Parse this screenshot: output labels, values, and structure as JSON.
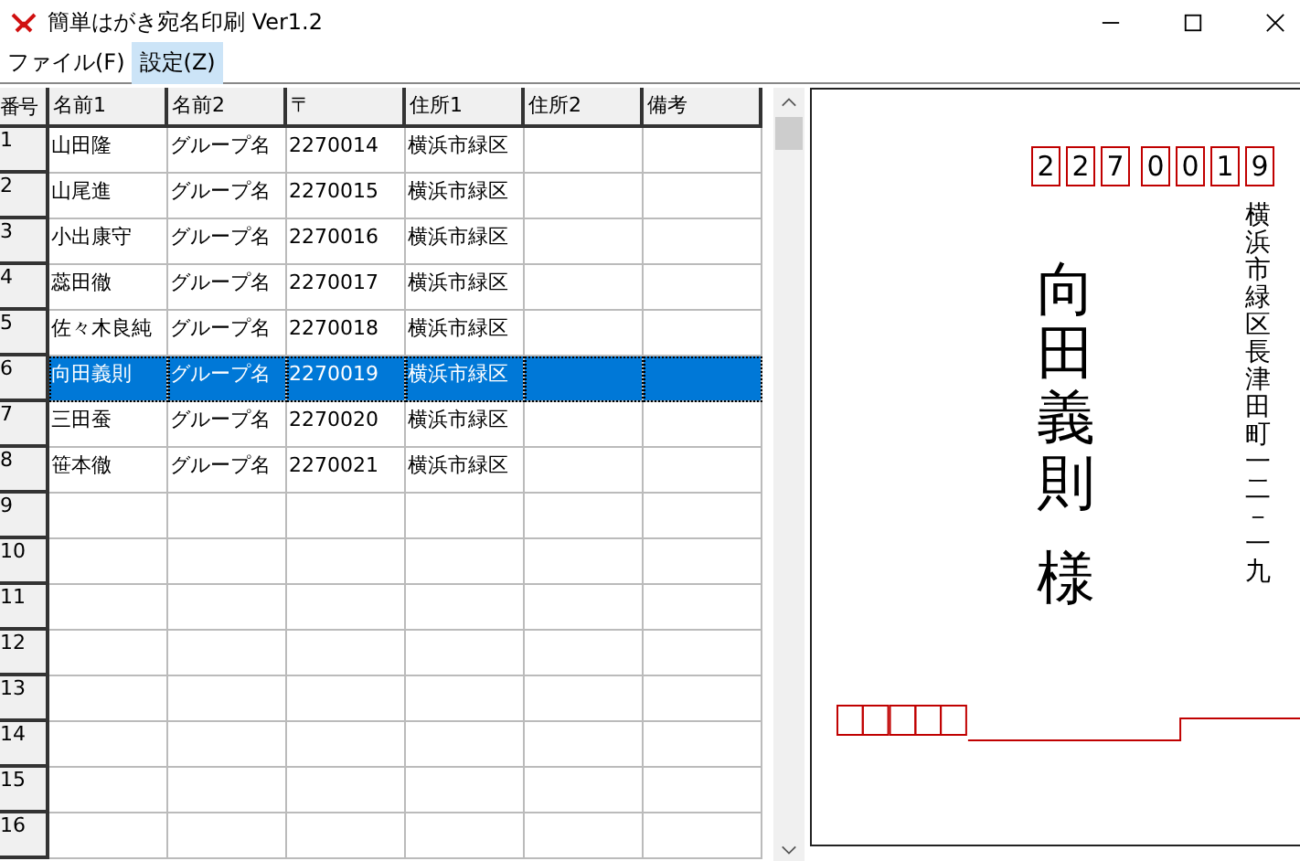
{
  "window": {
    "title": "簡単はがき宛名印刷 Ver1.2"
  },
  "menu": [
    {
      "label": "ファイル(F)",
      "selected": false
    },
    {
      "label": "設定(Z)",
      "selected": true
    }
  ],
  "table": {
    "corner": "番号",
    "columns": [
      "名前1",
      "名前2",
      "〒",
      "住所1",
      "住所2",
      "備考"
    ],
    "rows": [
      {
        "number": "1",
        "selected": false,
        "cells": [
          "山田隆",
          "グループ名",
          "2270014",
          "横浜市緑区",
          "",
          ""
        ]
      },
      {
        "number": "2",
        "selected": false,
        "cells": [
          "山尾進",
          "グループ名",
          "2270015",
          "横浜市緑区",
          "",
          ""
        ]
      },
      {
        "number": "3",
        "selected": false,
        "cells": [
          "小出康守",
          "グループ名",
          "2270016",
          "横浜市緑区",
          "",
          ""
        ]
      },
      {
        "number": "4",
        "selected": false,
        "cells": [
          "蕊田徹",
          "グループ名",
          "2270017",
          "横浜市緑区",
          "",
          ""
        ]
      },
      {
        "number": "5",
        "selected": false,
        "cells": [
          "佐々木良純",
          "グループ名",
          "2270018",
          "横浜市緑区",
          "",
          ""
        ]
      },
      {
        "number": "6",
        "selected": true,
        "cells": [
          "向田義則",
          "グループ名",
          "2270019",
          "横浜市緑区",
          "",
          ""
        ]
      },
      {
        "number": "7",
        "selected": false,
        "cells": [
          "三田蚕",
          "グループ名",
          "2270020",
          "横浜市緑区",
          "",
          ""
        ]
      },
      {
        "number": "8",
        "selected": false,
        "cells": [
          "笹本徹",
          "グループ名",
          "2270021",
          "横浜市緑区",
          "",
          ""
        ]
      },
      {
        "number": "9",
        "selected": false
      },
      {
        "number": "10",
        "selected": false
      },
      {
        "number": "11",
        "selected": false
      },
      {
        "number": "12",
        "selected": false
      },
      {
        "number": "13",
        "selected": false
      },
      {
        "number": "14",
        "selected": false
      },
      {
        "number": "15",
        "selected": false
      },
      {
        "number": "16",
        "selected": false
      }
    ]
  },
  "postcard": {
    "zip_digits": [
      "2",
      "2",
      "7",
      "0",
      "0",
      "1",
      "9"
    ],
    "name": "向田義則",
    "honorific": "様",
    "address": "横浜市緑区長津田町一二－一九"
  }
}
